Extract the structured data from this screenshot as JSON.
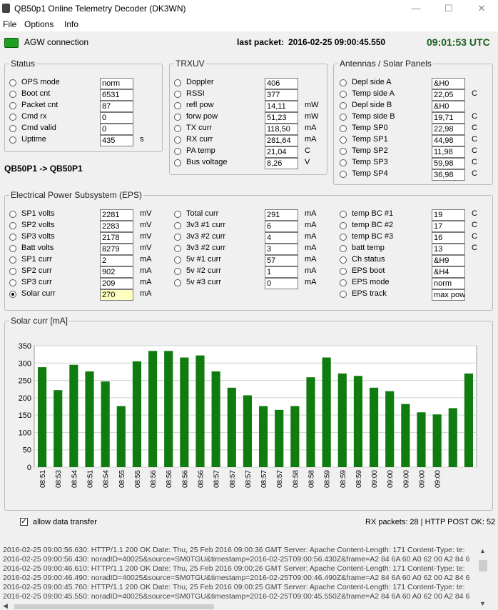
{
  "window": {
    "title": "QB50p1 Online Telemetry Decoder (DK3WN)",
    "minimize": "—",
    "maximize": "☐",
    "close": "✕"
  },
  "menu": [
    "File",
    "Options",
    "Info"
  ],
  "topbar": {
    "agw_label": "AGW connection",
    "last_packet_label": "last packet:",
    "last_packet_value": "2016-02-25 09:00:45.550",
    "clock": "09:01:53 UTC"
  },
  "status": {
    "title": "Status",
    "rows": [
      {
        "label": "OPS mode",
        "value": "norm",
        "unit": ""
      },
      {
        "label": "Boot cnt",
        "value": "6531",
        "unit": ""
      },
      {
        "label": "Packet cnt",
        "value": "87",
        "unit": ""
      },
      {
        "label": "Cmd rx",
        "value": "0",
        "unit": ""
      },
      {
        "label": "Cmd valid",
        "value": "0",
        "unit": ""
      },
      {
        "label": "Uptime",
        "value": "435",
        "unit": "s"
      }
    ]
  },
  "route": "QB50P1 -> QB50P1",
  "trxuv": {
    "title": "TRXUV",
    "rows": [
      {
        "label": "Doppler",
        "value": "406",
        "unit": ""
      },
      {
        "label": "RSSI",
        "value": "377",
        "unit": ""
      },
      {
        "label": "refl pow",
        "value": "14,11",
        "unit": "mW"
      },
      {
        "label": "forw pow",
        "value": "51,23",
        "unit": "mW"
      },
      {
        "label": "TX curr",
        "value": "118,50",
        "unit": "mA"
      },
      {
        "label": "RX curr",
        "value": "281,64",
        "unit": "mA"
      },
      {
        "label": "PA temp",
        "value": "21,04",
        "unit": "C"
      },
      {
        "label": "Bus voltage",
        "value": "8,26",
        "unit": "V"
      }
    ]
  },
  "antennas": {
    "title": "Antennas / Solar Panels",
    "rows": [
      {
        "label": "Depl side A",
        "value": "&H0",
        "unit": ""
      },
      {
        "label": "Temp side A",
        "value": "22,05",
        "unit": "C"
      },
      {
        "label": "Depl side B",
        "value": "&H0",
        "unit": ""
      },
      {
        "label": "Temp side B",
        "value": "19,71",
        "unit": "C"
      },
      {
        "label": "Temp SP0",
        "value": "22,98",
        "unit": "C"
      },
      {
        "label": "Temp SP1",
        "value": "44,98",
        "unit": "C"
      },
      {
        "label": "Temp SP2",
        "value": "11,98",
        "unit": "C"
      },
      {
        "label": "Temp SP3",
        "value": "59,98",
        "unit": "C"
      },
      {
        "label": "Temp SP4",
        "value": "36,98",
        "unit": "C"
      }
    ]
  },
  "eps": {
    "title": "Electrical Power Subsystem (EPS)",
    "col1": [
      {
        "label": "SP1 volts",
        "value": "2281",
        "unit": "mV"
      },
      {
        "label": "SP2 volts",
        "value": "2283",
        "unit": "mV"
      },
      {
        "label": "SP3 volts",
        "value": "2178",
        "unit": "mV"
      },
      {
        "label": "Batt volts",
        "value": "8279",
        "unit": "mV"
      },
      {
        "label": "SP1 curr",
        "value": "2",
        "unit": "mA"
      },
      {
        "label": "SP2 curr",
        "value": "902",
        "unit": "mA"
      },
      {
        "label": "SP3 curr",
        "value": "209",
        "unit": "mA"
      },
      {
        "label": "Solar curr",
        "value": "270",
        "unit": "mA",
        "selected": true
      }
    ],
    "col2": [
      {
        "label": "Total curr",
        "value": "291",
        "unit": "mA"
      },
      {
        "label": "3v3 #1 curr",
        "value": "6",
        "unit": "mA"
      },
      {
        "label": "3v3 #2 curr",
        "value": "4",
        "unit": "mA"
      },
      {
        "label": "3v3 #2 curr",
        "value": "3",
        "unit": "mA"
      },
      {
        "label": "5v #1 curr",
        "value": "57",
        "unit": "mA"
      },
      {
        "label": "5v #2 curr",
        "value": "1",
        "unit": "mA"
      },
      {
        "label": "5v #3 curr",
        "value": "0",
        "unit": "mA"
      }
    ],
    "col3": [
      {
        "label": "temp BC #1",
        "value": "19",
        "unit": "C"
      },
      {
        "label": "temp BC #2",
        "value": "17",
        "unit": "C"
      },
      {
        "label": "temp BC #3",
        "value": "16",
        "unit": "C"
      },
      {
        "label": "batt temp",
        "value": "13",
        "unit": "C"
      },
      {
        "label": "Ch status",
        "value": "&H9",
        "unit": ""
      },
      {
        "label": "EPS boot",
        "value": "&H4",
        "unit": ""
      },
      {
        "label": "EPS mode",
        "value": "norm",
        "unit": ""
      },
      {
        "label": "EPS track",
        "value": "max pow",
        "unit": ""
      }
    ]
  },
  "chart_panel_title": "Solar curr [mA]",
  "chart_data": {
    "type": "bar",
    "title": "Solar curr [mA]",
    "xlabel": "",
    "ylabel": "",
    "ylim": [
      0,
      350
    ],
    "yticks": [
      0,
      50,
      100,
      150,
      200,
      250,
      300,
      350
    ],
    "grid": true,
    "color": "#107c10",
    "categories": [
      "08:51",
      "08:53",
      "08:54",
      "08:51",
      "08:54",
      "08:55",
      "08:55",
      "08:56",
      "08:56",
      "08:56",
      "08:56",
      "08:57",
      "08:57",
      "08:57",
      "08:57",
      "08:57",
      "08:58",
      "08:58",
      "08:59",
      "08:59",
      "08:59",
      "09:00",
      "09:00",
      "09:00",
      "09:00",
      "09:00"
    ],
    "values": [
      288,
      222,
      295,
      276,
      247,
      176,
      305,
      335,
      335,
      316,
      322,
      276,
      229,
      207,
      176,
      165,
      176,
      259,
      316,
      270,
      263,
      229,
      219,
      182,
      158,
      152,
      170,
      270
    ]
  },
  "bottom": {
    "allow_label": "allow data transfer",
    "counters": "RX packets: 28 | HTTP POST OK: 52"
  },
  "log": [
    "2016-02-25 09:00:56.630: HTTP/1.1 200 OK Date: Thu, 25 Feb 2016 09:00:36 GMT Server: Apache Content-Length: 171 Content-Type: te:",
    "2016-02-25 09:00:56.430: noradID=40025&source=SM0TGU&timestamp=2016-02-25T09:00:56.430Z&frame=A2 84 6A 60 A0 62 00 A2 84 6",
    "2016-02-25 09:00:46.610: HTTP/1.1 200 OK Date: Thu, 25 Feb 2016 09:00:26 GMT Server: Apache Content-Length: 171 Content-Type: te:",
    "2016-02-25 09:00:46.490: noradID=40025&source=SM0TGU&timestamp=2016-02-25T09:00:46.490Z&frame=A2 84 6A 60 A0 62 00 A2 84 6",
    "2016-02-25 09:00:45.760: HTTP/1.1 200 OK Date: Thu, 25 Feb 2016 09:00:25 GMT Server: Apache Content-Length: 171 Content-Type: te:",
    "2016-02-25 09:00:45.550: noradID=40025&source=SM0TGU&timestamp=2016-02-25T09:00:45.550Z&frame=A2 84 6A 60 A0 62 00 A2 84 6"
  ]
}
